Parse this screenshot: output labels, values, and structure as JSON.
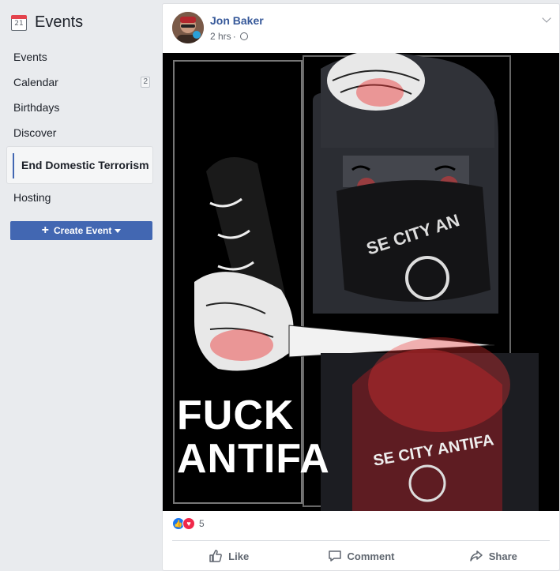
{
  "sidebar": {
    "title": "Events",
    "calendar_icon_day": "21",
    "items": [
      {
        "label": "Events"
      },
      {
        "label": "Calendar",
        "count": "2"
      },
      {
        "label": "Birthdays"
      },
      {
        "label": "Discover"
      },
      {
        "label": "End Domestic Terrorism",
        "active": true
      },
      {
        "label": "Hosting"
      }
    ],
    "create_button": {
      "label": "Create Event",
      "icon": "plus-icon"
    }
  },
  "post": {
    "author": "Jon Baker",
    "time": "2 hrs",
    "privacy_icon": "globe-icon",
    "image_text_line1": "FUCK",
    "image_text_line2": "ANTIFA",
    "reaction_count": "5",
    "actions": {
      "like": "Like",
      "comment": "Comment",
      "share": "Share"
    }
  },
  "colors": {
    "brand": "#4267b2",
    "link": "#365899",
    "background": "#e9ebee",
    "like_blue": "#1877f2",
    "love_red": "#f0284a"
  }
}
